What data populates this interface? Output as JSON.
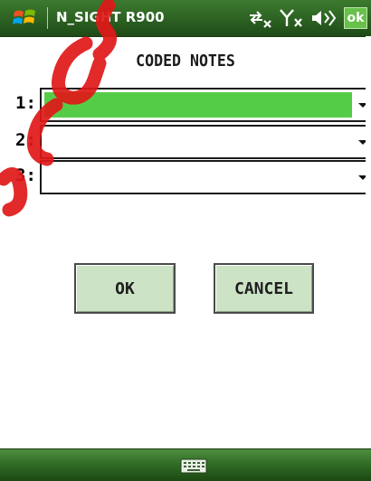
{
  "title_bar": {
    "app_title": "N_SIGHT R900",
    "ok_label": "ok",
    "icons": [
      "windows-start-icon",
      "connectivity-icon",
      "signal-off-icon",
      "volume-icon"
    ]
  },
  "dialog": {
    "heading": "CODED NOTES",
    "notes": [
      {
        "label": "1:",
        "value": "",
        "selected": true
      },
      {
        "label": "2:",
        "value": "",
        "selected": false
      },
      {
        "label": "3:",
        "value": "",
        "selected": false
      }
    ],
    "ok_button": "OK",
    "cancel_button": "CANCEL"
  },
  "bottom_bar": {
    "icon": "keyboard-icon"
  },
  "colors": {
    "title_green": "#2c6122",
    "selection_green": "#55cc48",
    "button_face": "#cce3c6",
    "watermark_red": "#e01818"
  }
}
